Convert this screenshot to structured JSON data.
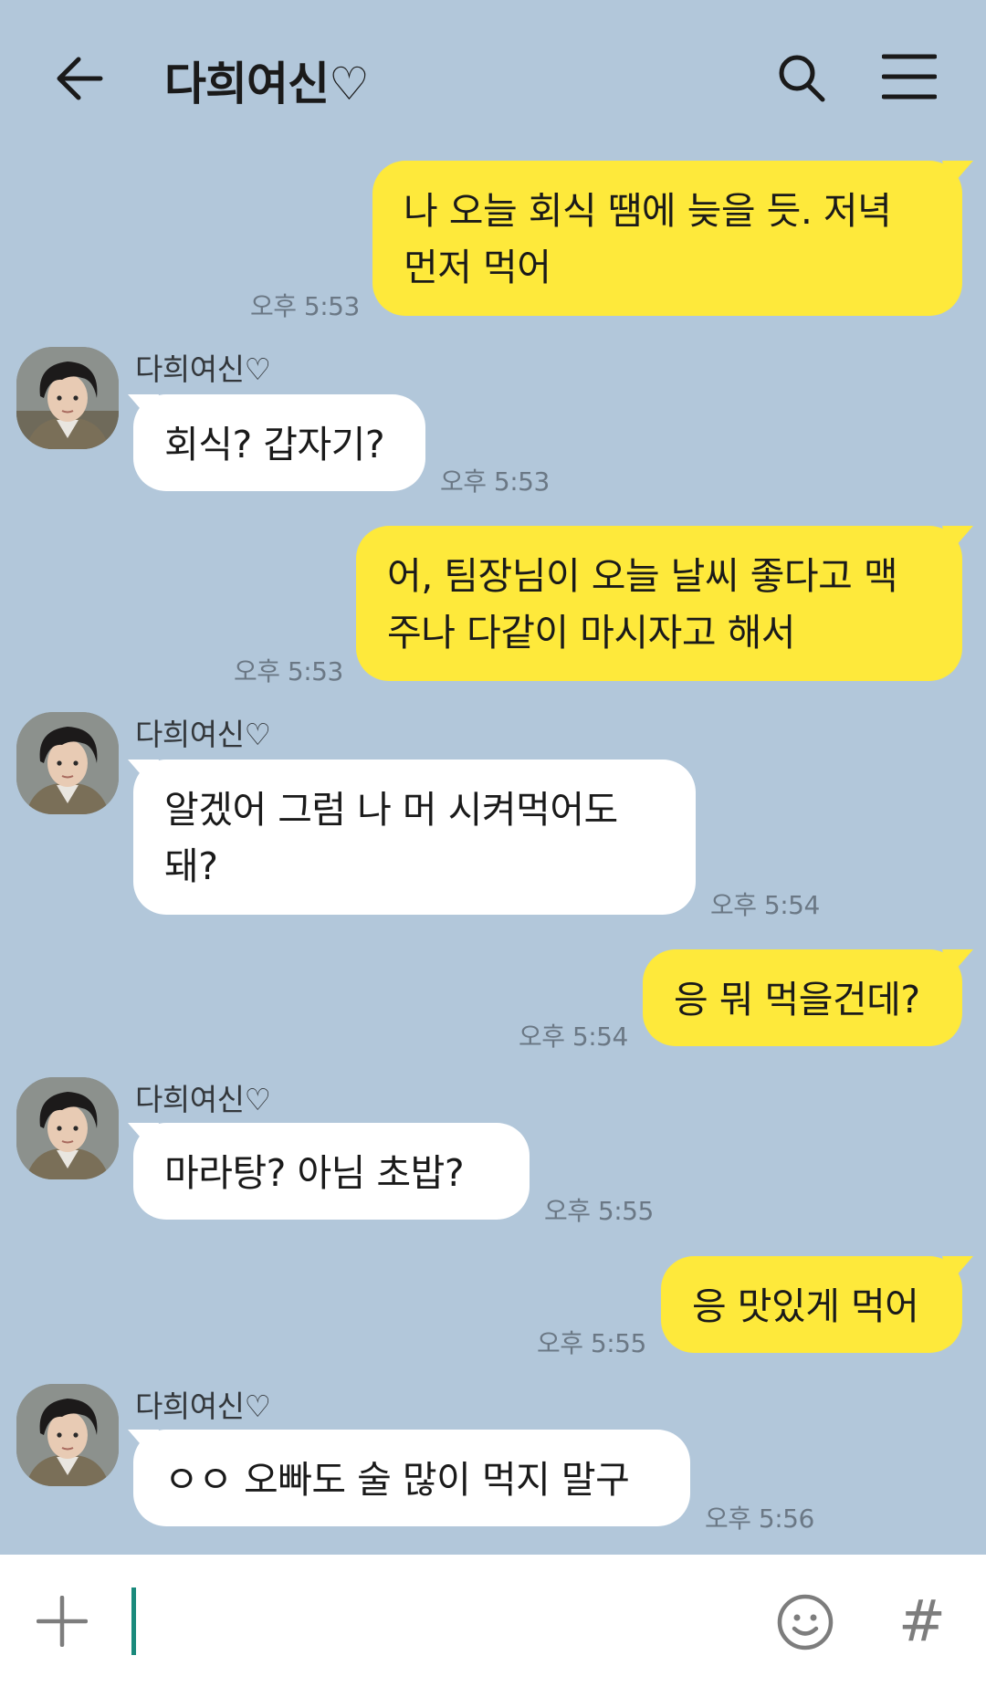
{
  "header": {
    "title": "다희여신♡",
    "back_icon": "arrow-left-icon",
    "search_icon": "search-icon",
    "menu_icon": "hamburger-menu-icon"
  },
  "colors": {
    "background": "#b2c7da",
    "my_bubble": "#fee93b",
    "their_bubble": "#ffffff",
    "caret": "#1a8a7c"
  },
  "messages": [
    {
      "from": "me",
      "text": "나 오늘 회식 땜에 늦을 듯. 저녁\n먼저 먹어",
      "time": "오후 5:53"
    },
    {
      "from": "them",
      "sender": "다희여신♡",
      "text": "회식? 갑자기?",
      "time": "오후 5:53"
    },
    {
      "from": "me",
      "text": "어, 팀장님이 오늘 날씨 좋다고 맥\n주나 다같이 마시자고 해서",
      "time": "오후 5:53"
    },
    {
      "from": "them",
      "sender": "다희여신♡",
      "text": "알겠어 그럼 나 머 시켜먹어도\n돼?",
      "time": "오후 5:54"
    },
    {
      "from": "me",
      "text": "응 뭐 먹을건데?",
      "time": "오후 5:54"
    },
    {
      "from": "them",
      "sender": "다희여신♡",
      "text": "마라탕? 아님 초밥?",
      "time": "오후 5:55"
    },
    {
      "from": "me",
      "text": "응 맛있게 먹어",
      "time": "오후 5:55"
    },
    {
      "from": "them",
      "sender": "다희여신♡",
      "text": "ㅇㅇ 오빠도 술 많이 먹지 말구",
      "time": "오후 5:56"
    }
  ],
  "input": {
    "value": "",
    "plus_icon": "plus-icon",
    "emoji_icon": "emoji-smile-icon",
    "hash_label": "#"
  }
}
